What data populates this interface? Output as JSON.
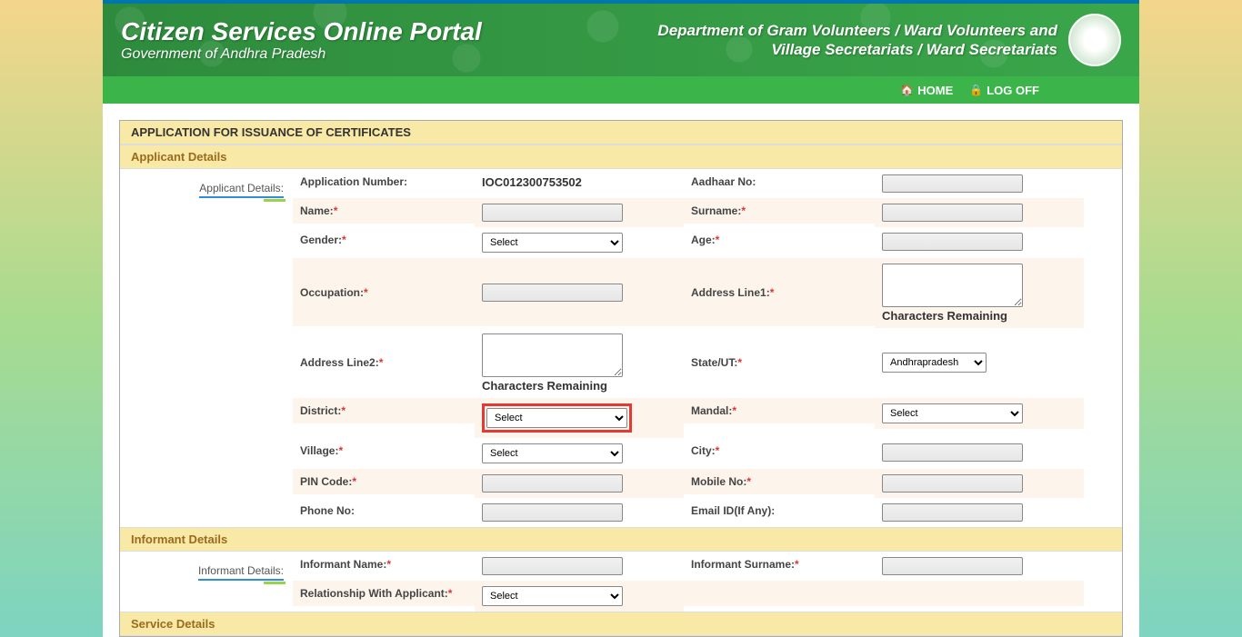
{
  "header": {
    "title": "Citizen Services Online Portal",
    "subtitle": "Government of Andhra Pradesh",
    "department_l1": "Department of Gram Volunteers / Ward Volunteers and",
    "department_l2": "Village Secretariats / Ward Secretariats"
  },
  "nav": {
    "home": "HOME",
    "logoff": "LOG OFF"
  },
  "form": {
    "title": "APPLICATION FOR ISSUANCE OF CERTIFICATES",
    "sections": {
      "applicant": "Applicant Details",
      "informant": "Informant Details",
      "service": "Service Details"
    },
    "tabs": {
      "applicant": "Applicant Details:",
      "informant": "Informant Details:"
    },
    "labels": {
      "app_no": "Application Number:",
      "aadhaar": "Aadhaar No:",
      "name": "Name:",
      "surname": "Surname:",
      "gender": "Gender:",
      "age": "Age:",
      "occupation": "Occupation:",
      "addr1": "Address Line1:",
      "addr2": "Address Line2:",
      "state": "State/UT:",
      "district": "District:",
      "mandal": "Mandal:",
      "village": "Village:",
      "city": "City:",
      "pin": "PIN Code:",
      "mobile": "Mobile No:",
      "phone": "Phone No:",
      "email": "Email ID(If Any):",
      "inf_name": "Informant Name:",
      "inf_surname": "Informant Surname:",
      "relation": "Relationship With Applicant:"
    },
    "values": {
      "app_no": "IOC012300753502",
      "chars_remaining": "Characters Remaining"
    },
    "options": {
      "select": "Select",
      "state_default": "Andhrapradesh"
    }
  }
}
